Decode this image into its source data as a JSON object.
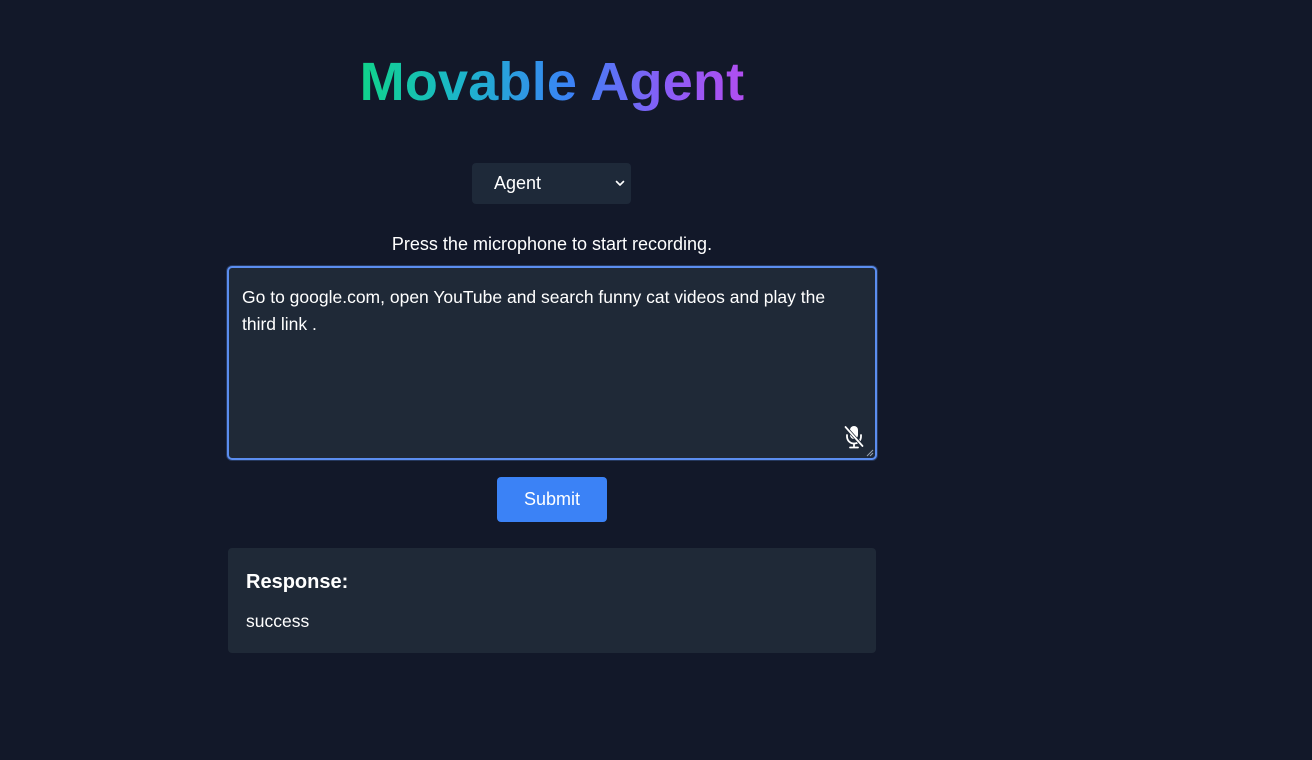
{
  "header": {
    "title": "Movable Agent"
  },
  "mode_select": {
    "selected": "Agent",
    "icon": "chevron-down-icon"
  },
  "recorder": {
    "hint": "Press the microphone to start recording.",
    "prompt_value": "Go to google.com, open YouTube and search funny cat videos and play the third link .",
    "mic_icon": "microphone-off-icon"
  },
  "actions": {
    "submit_label": "Submit"
  },
  "response": {
    "heading": "Response:",
    "text": "success"
  },
  "colors": {
    "background": "#121829",
    "panel": "#1f2937",
    "accent": "#3b82f6",
    "title_gradient": [
      "#10d38a",
      "#3b82f6",
      "#b14ef0"
    ]
  }
}
